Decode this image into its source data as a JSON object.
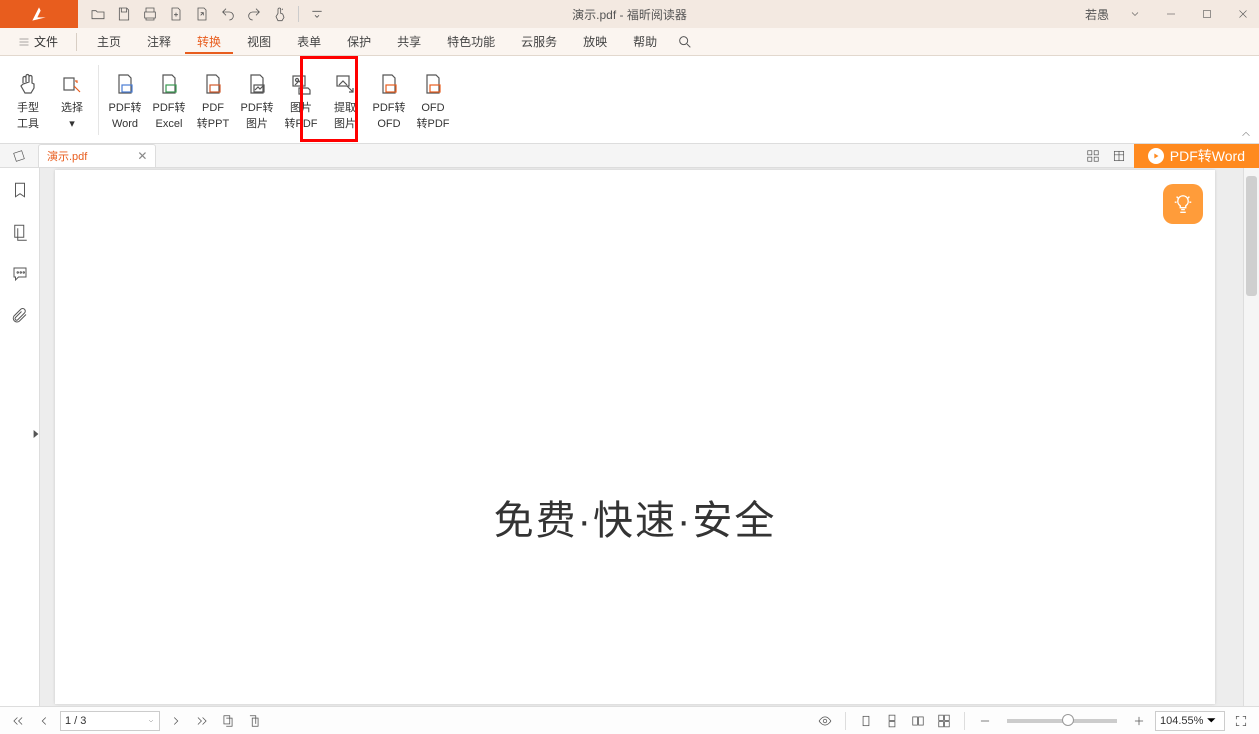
{
  "title": {
    "doc": "演示.pdf",
    "app": "福昕阅读器",
    "full": "演示.pdf - 福昕阅读器"
  },
  "user": "若愚",
  "menu": {
    "file": "文件",
    "items": [
      "主页",
      "注释",
      "转换",
      "视图",
      "表单",
      "保护",
      "共享",
      "特色功能",
      "云服务",
      "放映",
      "帮助"
    ],
    "active_index": 2
  },
  "ribbon": {
    "hand": {
      "l1": "手型",
      "l2": "工具"
    },
    "select": {
      "l1": "选择",
      "l2": "▾"
    },
    "pdf_word": {
      "l1": "PDF转",
      "l2": "Word"
    },
    "pdf_excel": {
      "l1": "PDF转",
      "l2": "Excel"
    },
    "pdf_ppt": {
      "l1": "PDF",
      "l2": "转PPT"
    },
    "pdf_img": {
      "l1": "PDF转",
      "l2": "图片"
    },
    "img_pdf": {
      "l1": "图片",
      "l2": "转PDF"
    },
    "extract_img": {
      "l1": "提取",
      "l2": "图片"
    },
    "pdf_ofd": {
      "l1": "PDF转",
      "l2": "OFD"
    },
    "ofd_pdf": {
      "l1": "OFD",
      "l2": "转PDF"
    }
  },
  "tab": {
    "name": "演示.pdf"
  },
  "promo_button": "PDF转Word",
  "page_content": "免费·快速·安全",
  "status": {
    "page": "1 / 3",
    "zoom": "104.55%"
  }
}
